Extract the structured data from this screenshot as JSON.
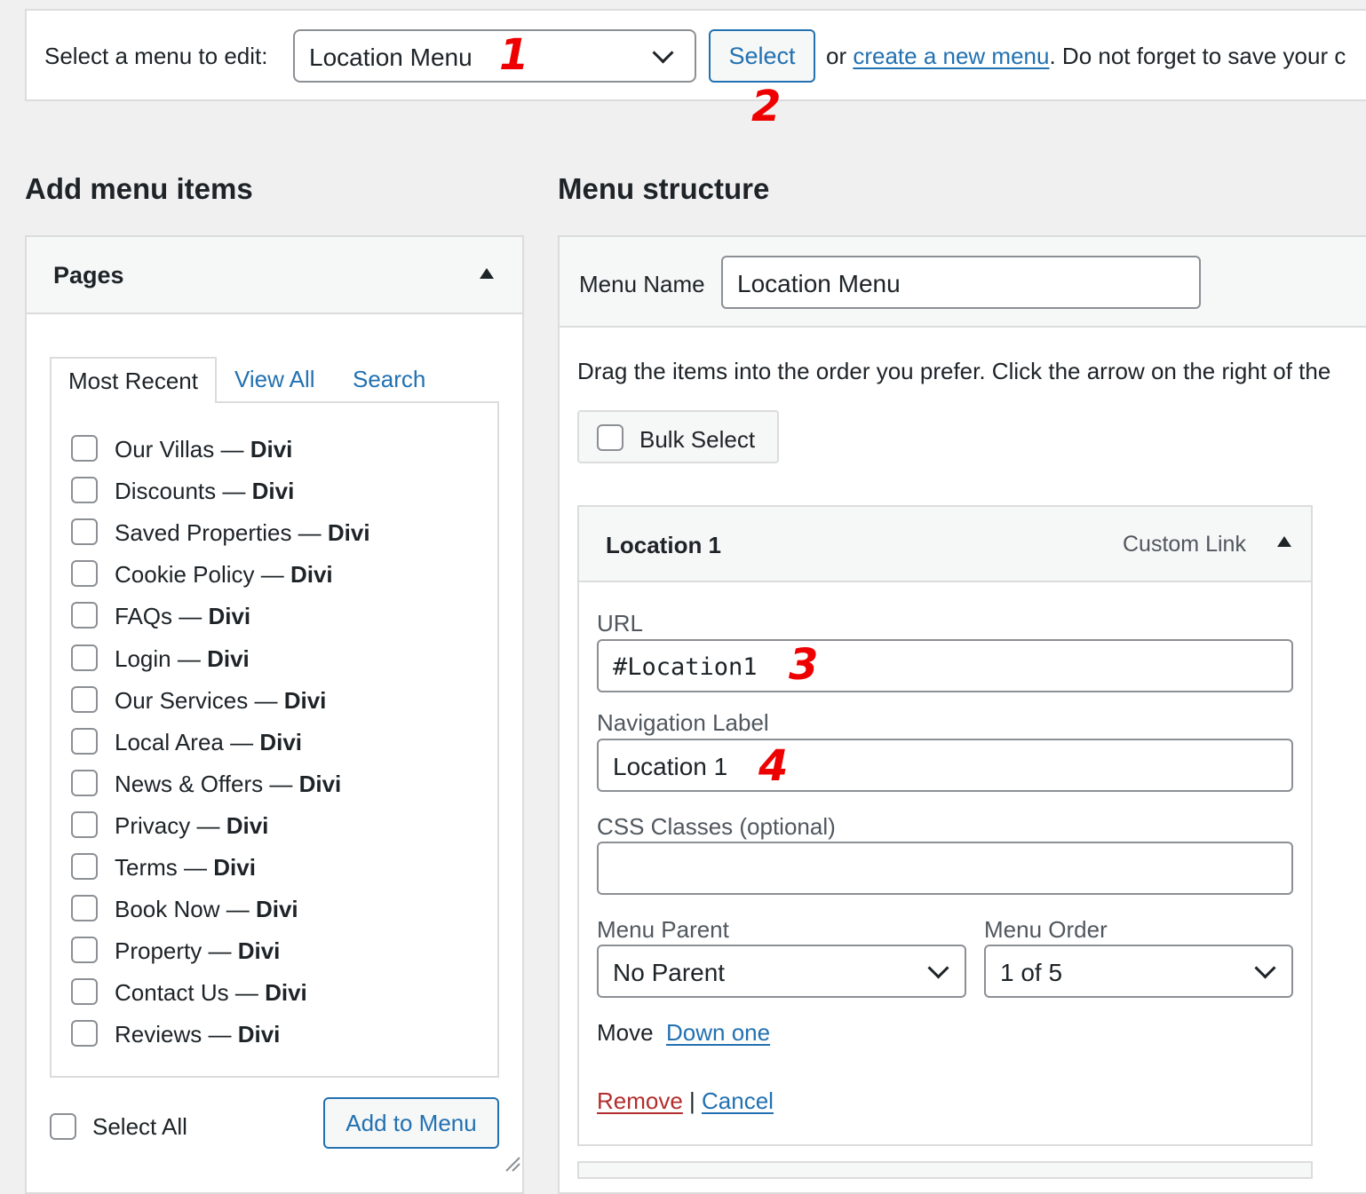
{
  "topbar": {
    "label": "Select a menu to edit:",
    "selected_menu": "Location Menu",
    "select_button": "Select",
    "or_text": "or ",
    "create_link": "create a new menu",
    "tail_text": ". Do not forget to save your c"
  },
  "markers": [
    "1",
    "2",
    "3",
    "4"
  ],
  "left": {
    "heading": "Add menu items",
    "panel_title": "Pages",
    "tabs": [
      "Most Recent",
      "View All",
      "Search"
    ],
    "separator": " — ",
    "pages": [
      {
        "name": "Our Villas",
        "tag": "Divi"
      },
      {
        "name": "Discounts",
        "tag": "Divi"
      },
      {
        "name": "Saved Properties",
        "tag": "Divi"
      },
      {
        "name": "Cookie Policy",
        "tag": "Divi"
      },
      {
        "name": "FAQs",
        "tag": "Divi"
      },
      {
        "name": "Login",
        "tag": "Divi"
      },
      {
        "name": "Our Services",
        "tag": "Divi"
      },
      {
        "name": "Local Area",
        "tag": "Divi"
      },
      {
        "name": "News & Offers",
        "tag": "Divi"
      },
      {
        "name": "Privacy",
        "tag": "Divi"
      },
      {
        "name": "Terms",
        "tag": "Divi"
      },
      {
        "name": "Book Now",
        "tag": "Divi"
      },
      {
        "name": "Property",
        "tag": "Divi"
      },
      {
        "name": "Contact Us",
        "tag": "Divi"
      },
      {
        "name": "Reviews",
        "tag": "Divi"
      }
    ],
    "select_all": "Select All",
    "add_button": "Add to Menu"
  },
  "right": {
    "heading": "Menu structure",
    "menu_name_label": "Menu Name",
    "menu_name_value": "Location Menu",
    "instructions": "Drag the items into the order you prefer. Click the arrow on the right of the",
    "bulk_select": "Bulk Select",
    "item": {
      "title": "Location 1",
      "type": "Custom Link",
      "url_label": "URL",
      "url_value": "#Location1",
      "nav_label_label": "Navigation Label",
      "nav_label_value": "Location 1",
      "css_label": "CSS Classes (optional)",
      "css_value": "",
      "parent_label": "Menu Parent",
      "parent_value": "No Parent",
      "order_label": "Menu Order",
      "order_value": "1 of 5",
      "move_label": "Move",
      "move_link": "Down one",
      "remove": "Remove",
      "pipe": "|",
      "cancel": "Cancel"
    }
  },
  "colors": {
    "accent": "#2271b1",
    "danger": "#b32d2e",
    "marker": "#e00000",
    "background": "#f0f0f1"
  }
}
